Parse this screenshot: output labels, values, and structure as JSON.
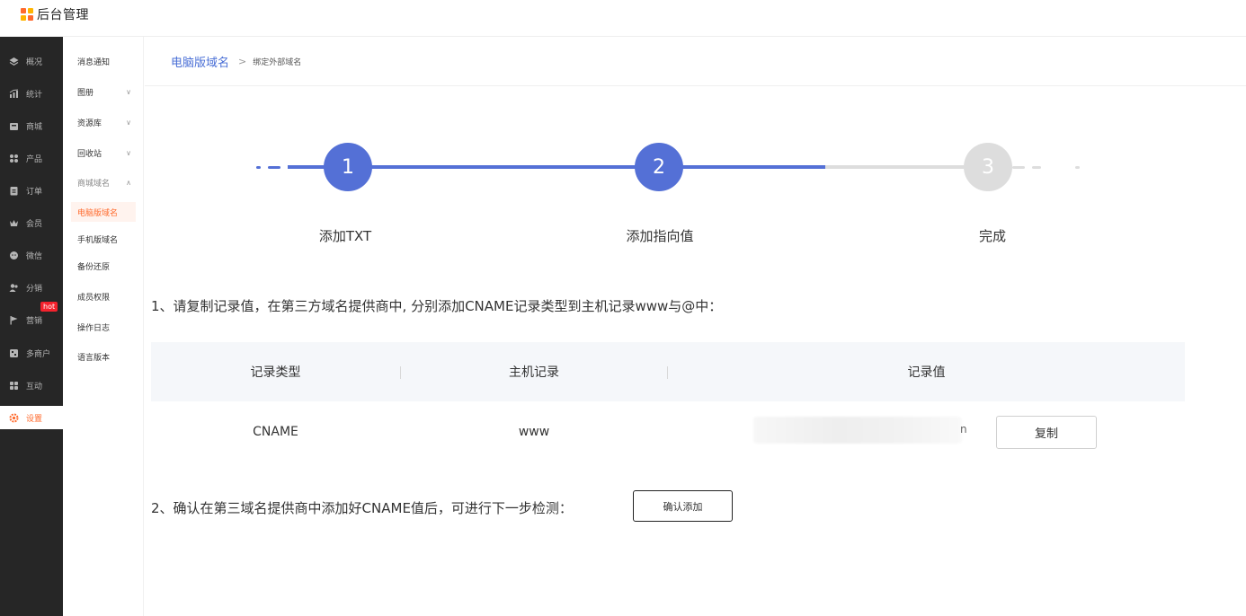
{
  "app": {
    "title": "后台管理"
  },
  "sidebar": {
    "items": [
      {
        "label": "概况",
        "icon": "layers-icon"
      },
      {
        "label": "统计",
        "icon": "stats-icon"
      },
      {
        "label": "商城",
        "icon": "shop-icon"
      },
      {
        "label": "产品",
        "icon": "grid-icon"
      },
      {
        "label": "订单",
        "icon": "order-icon"
      },
      {
        "label": "会员",
        "icon": "crown-icon"
      },
      {
        "label": "微信",
        "icon": "wechat-icon"
      },
      {
        "label": "分销",
        "icon": "users-icon"
      },
      {
        "label": "营销",
        "icon": "flag-icon"
      },
      {
        "label": "多商户",
        "icon": "merchant-icon"
      },
      {
        "label": "互动",
        "icon": "interact-icon"
      },
      {
        "label": "设置",
        "icon": "gear-icon"
      }
    ],
    "hot_badge": "hot"
  },
  "submenu": {
    "items": [
      {
        "label": "消息通知"
      },
      {
        "label": "图册"
      },
      {
        "label": "资源库"
      },
      {
        "label": "回收站"
      },
      {
        "label": "商城域名"
      },
      {
        "label": "电脑版域名"
      },
      {
        "label": "手机版域名"
      },
      {
        "label": "备份还原"
      },
      {
        "label": "成员权限"
      },
      {
        "label": "操作日志"
      },
      {
        "label": "语言版本"
      }
    ]
  },
  "breadcrumb": {
    "parent": "电脑版域名",
    "separator": ">",
    "current": "绑定外部域名"
  },
  "steps": [
    {
      "number": "1",
      "label": "添加TXT"
    },
    {
      "number": "2",
      "label": "添加指向值"
    },
    {
      "number": "3",
      "label": "完成"
    }
  ],
  "instructions": {
    "step1": "1、请复制记录值，在第三方域名提供商中, 分别添加CNAME记录类型到主机记录www与@中：",
    "step2": "2、确认在第三域名提供商中添加好CNAME值后，可进行下一步检测："
  },
  "table": {
    "headers": [
      "记录类型",
      "主机记录",
      "记录值"
    ],
    "row": {
      "type": "CNAME",
      "host": "www",
      "value_tail": "n"
    },
    "copy_label": "复制"
  },
  "confirm_label": "确认添加",
  "colors": {
    "accent": "#5470d6",
    "active": "#ff6a2c",
    "inactive_step": "#dddddd",
    "sidebar_bg": "#262626"
  }
}
